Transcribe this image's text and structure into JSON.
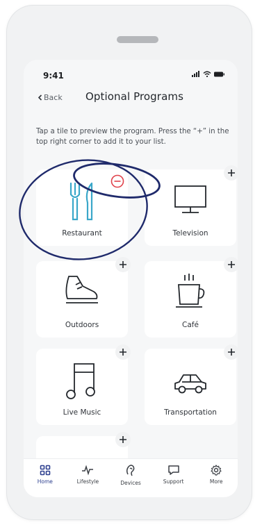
{
  "status_bar": {
    "time": "9:41"
  },
  "nav": {
    "back_label": "Back",
    "title": "Optional Programs"
  },
  "instructions": "Tap a tile to preview the program. Press the “+” in the top right corner to add it to your list.",
  "tiles": [
    {
      "label": "Restaurant",
      "icon": "fork-knife-icon",
      "state": "added",
      "badge": "minus-circle-icon"
    },
    {
      "label": "Television",
      "icon": "television-icon",
      "state": "available",
      "badge": "plus-icon"
    },
    {
      "label": "Outdoors",
      "icon": "shoe-icon",
      "state": "available",
      "badge": "plus-icon"
    },
    {
      "label": "Café",
      "icon": "coffee-cup-icon",
      "state": "available",
      "badge": "plus-icon"
    },
    {
      "label": "Live Music",
      "icon": "music-note-icon",
      "state": "available",
      "badge": "plus-icon"
    },
    {
      "label": "Transportation",
      "icon": "car-icon",
      "state": "available",
      "badge": "plus-icon"
    },
    {
      "label": "",
      "icon": "",
      "state": "available",
      "badge": "plus-icon"
    }
  ],
  "bottom_nav": [
    {
      "label": "Home",
      "icon": "home-grid-icon",
      "active": true
    },
    {
      "label": "Lifestyle",
      "icon": "activity-icon",
      "active": false
    },
    {
      "label": "Devices",
      "icon": "hearing-aid-icon",
      "active": false
    },
    {
      "label": "Support",
      "icon": "chat-bubble-icon",
      "active": false
    },
    {
      "label": "More",
      "icon": "gear-icon",
      "active": false
    }
  ],
  "colors": {
    "accent_blue": "#3aa7c9",
    "remove_red": "#e0424b",
    "annotation_navy": "#1f2a6b",
    "active_nav": "#2d3f8f"
  }
}
